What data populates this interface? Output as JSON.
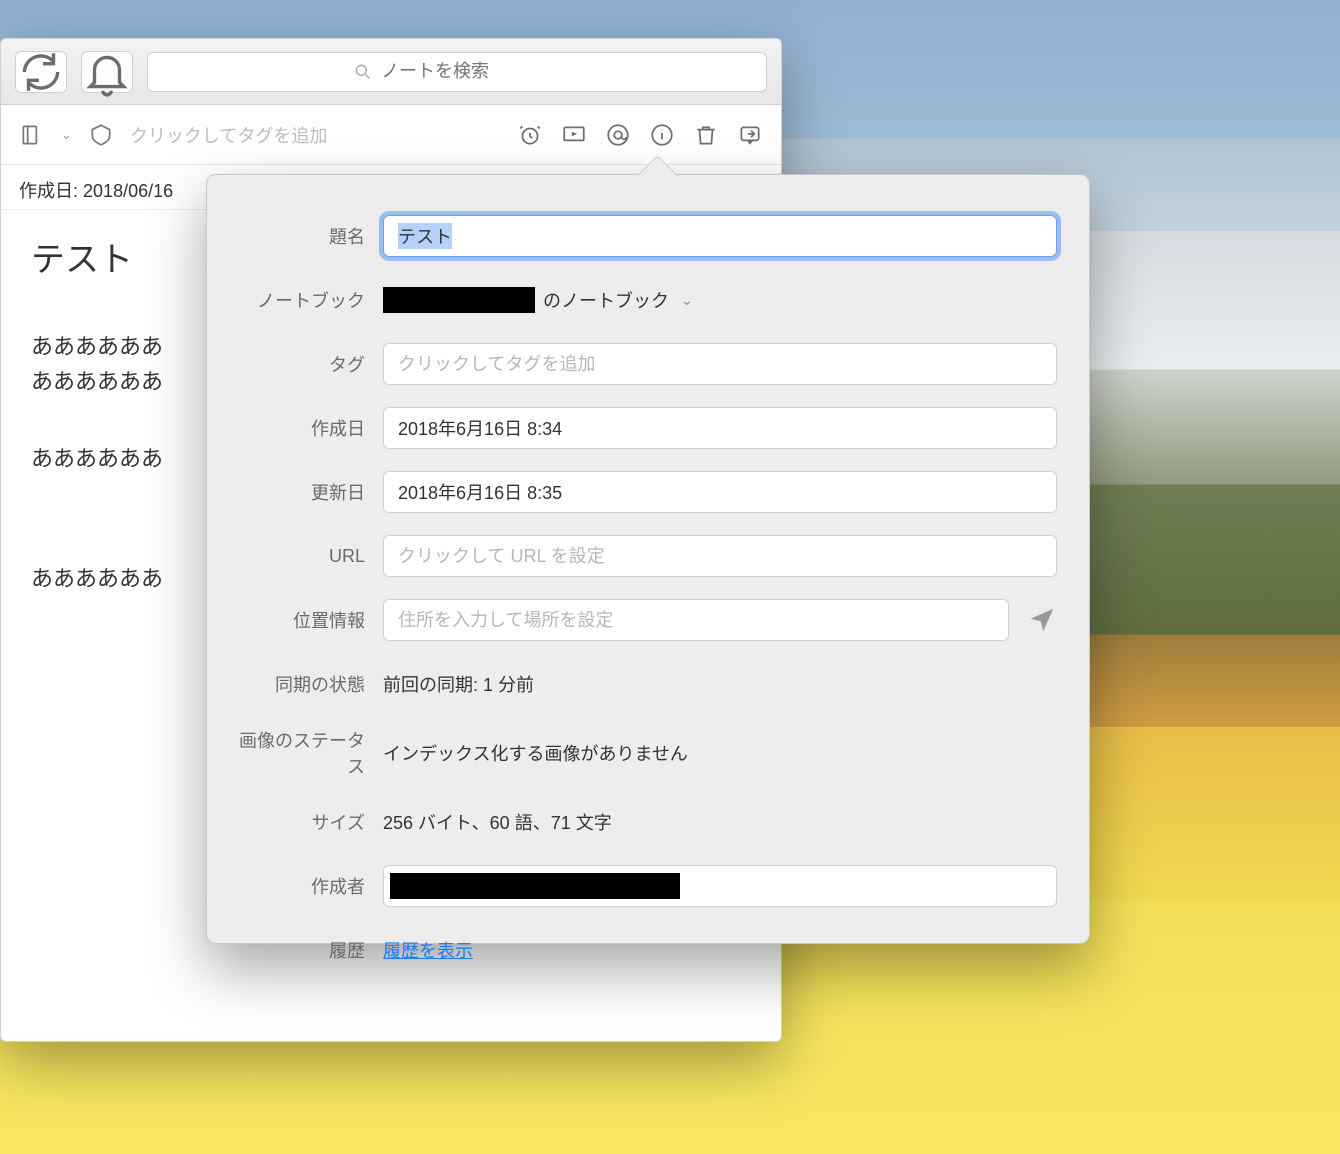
{
  "toolbar": {
    "search_placeholder": "ノートを検索"
  },
  "tagbar": {
    "tag_placeholder": "クリックしてタグを追加"
  },
  "meta": {
    "created_label": "作成日:",
    "created_date": "2018/06/16"
  },
  "note": {
    "title": "テスト",
    "body_lines": [
      "ああああああ",
      "ああああああ",
      "",
      "ああああああ",
      "",
      "",
      "ああああああ"
    ]
  },
  "popover": {
    "labels": {
      "title": "題名",
      "notebook": "ノートブック",
      "tags": "タグ",
      "created": "作成日",
      "updated": "更新日",
      "url": "URL",
      "location": "位置情報",
      "sync": "同期の状態",
      "image": "画像のステータス",
      "size": "サイズ",
      "author": "作成者",
      "history": "履歴"
    },
    "values": {
      "title": "テスト",
      "notebook_suffix": "のノートブック",
      "tags_placeholder": "クリックしてタグを追加",
      "created": "2018年6月16日 8:34",
      "updated": "2018年6月16日 8:35",
      "url_placeholder": "クリックして URL を設定",
      "location_placeholder": "住所を入力して場所を設定",
      "sync": "前回の同期: 1 分前",
      "image": "インデックス化する画像がありません",
      "size": "256 バイト、60 語、71 文字",
      "history_link": "履歴を表示"
    }
  }
}
